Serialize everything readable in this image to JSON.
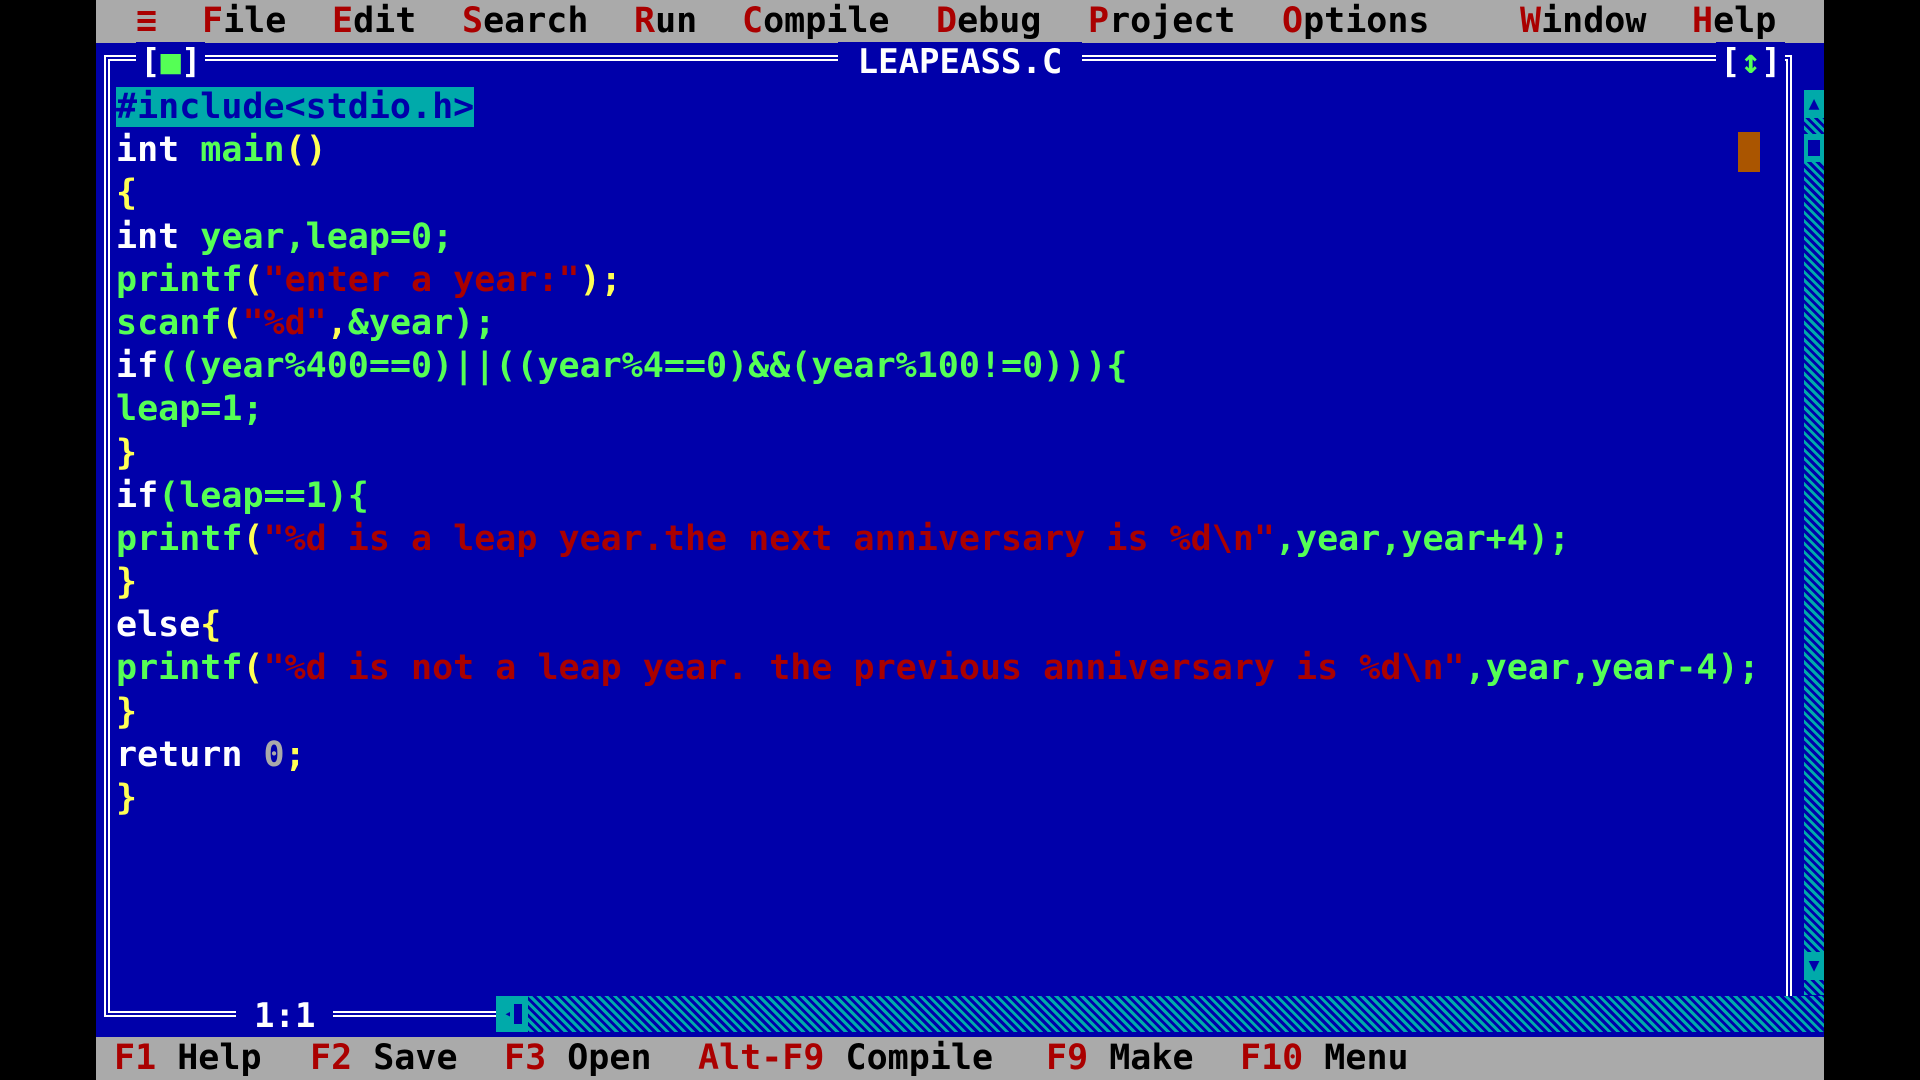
{
  "menu": {
    "system_icon": "≡",
    "items": [
      {
        "hot": "F",
        "rest": "ile"
      },
      {
        "hot": "E",
        "rest": "dit"
      },
      {
        "hot": "S",
        "rest": "earch"
      },
      {
        "hot": "R",
        "rest": "un"
      },
      {
        "hot": "C",
        "rest": "ompile"
      },
      {
        "hot": "D",
        "rest": "ebug"
      },
      {
        "hot": "P",
        "rest": "roject"
      },
      {
        "hot": "O",
        "rest": "ptions"
      },
      {
        "hot": "W",
        "rest": "indow"
      },
      {
        "hot": "H",
        "rest": "elp"
      }
    ]
  },
  "window": {
    "title": "LEAPEASS.C",
    "close_box": "[■]",
    "zoom_box": "[↕]",
    "position": "1:1"
  },
  "code": {
    "line1": "#include<stdio.h>",
    "line2_kw": "int",
    "line2_id": "main",
    "line2_tail": "()",
    "line3": "{",
    "line4_kw": "int",
    "line4_rest": "year,leap=0;",
    "line5_fn": "printf",
    "line5_str": "\"enter a year:\"",
    "line6_fn": "scanf",
    "line6_str": "\"%d\"",
    "line6_rest": "&year);",
    "line7_kw": "if",
    "line7_rest": "((year%400==0)||((year%4==0)&&(year%100!=0))){",
    "line8": "leap=1;",
    "line9": "}",
    "line10_kw": "if",
    "line10_rest": "(leap==1){",
    "line11_fn": "printf",
    "line11_str": "\"%d is a leap year.the next anniversary is %d\\n\"",
    "line11_rest": ",year,year+4);",
    "line12": "}",
    "line13_kw": "else",
    "line13_rest": "{",
    "line14_fn": "printf",
    "line14_str": "\"%d is not a leap year. the previous anniversary is %d\\n\"",
    "line14_rest": ",year,year-4);",
    "line15": "}",
    "line16_kw": "return",
    "line16_num": "0",
    "line16_rest": ";",
    "line17": "}"
  },
  "function_keys": [
    {
      "key": "F1",
      "label": "Help"
    },
    {
      "key": "F2",
      "label": "Save"
    },
    {
      "key": "F3",
      "label": "Open"
    },
    {
      "key": "Alt-F9",
      "label": "Compile"
    },
    {
      "key": "F9",
      "label": "Make"
    },
    {
      "key": "F10",
      "label": "Menu"
    }
  ],
  "colors": {
    "background": "#0000aa",
    "menu_bar": "#aaaaaa",
    "hotkey": "#aa0000",
    "keyword": "#ffffff",
    "identifier": "#55ff55",
    "string": "#aa0000",
    "punctuation": "#ffff55",
    "preprocessor_bg": "#00aaaa"
  }
}
